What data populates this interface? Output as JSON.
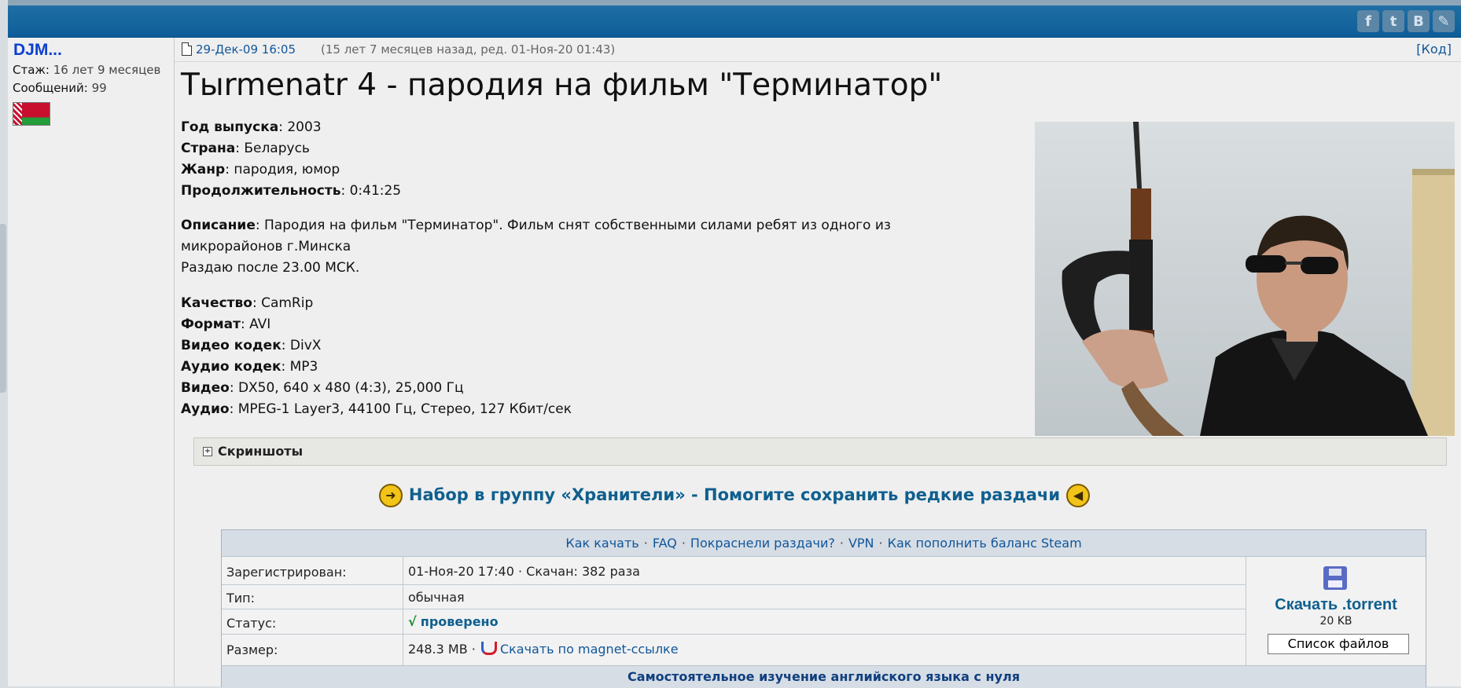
{
  "social": [
    {
      "icon": "facebook-icon",
      "glyph": "f"
    },
    {
      "icon": "twitter-icon",
      "glyph": "t"
    },
    {
      "icon": "vk-icon",
      "glyph": "B"
    },
    {
      "icon": "pencil-icon",
      "glyph": "✎"
    }
  ],
  "user": {
    "name": "DJM...",
    "stage_label": "Стаж:",
    "stage_value": "16 лет 9 месяцев",
    "posts_label": "Сообщений:",
    "posts_value": "99"
  },
  "post": {
    "date": "29-Дек-09 16:05",
    "note": "(15 лет 7 месяцев назад, ред. 01-Ноя-20 01:43)",
    "code_link": "[Код]",
    "title": "Тыrmenatr 4 - пародия на фильм \"Терминатор\""
  },
  "details": {
    "year_label": "Год выпуска",
    "year": ": 2003",
    "country_label": "Страна",
    "country": ": Беларусь",
    "genre_label": "Жанр",
    "genre": ": пародия, юмор",
    "duration_label": "Продолжительность",
    "duration": ": 0:41:25",
    "desc_label": "Описание",
    "desc_line1": ": Пародия на фильм \"Терминатор\". Фильм снят собственными силами ребят из одного из",
    "desc_line2": "микрорайонов г.Минска",
    "desc_line3": "Раздаю после 23.00 МСК.",
    "quality_label": "Качество",
    "quality": ": CamRip",
    "format_label": "Формат",
    "format": ": AVI",
    "vcodec_label": "Видео кодек",
    "vcodec": ": DivX",
    "acodec_label": "Аудио кодек",
    "acodec": ": MP3",
    "video_label": "Видео",
    "video": ": DX50, 640 x 480 (4:3), 25,000 Гц",
    "audio_label": "Аудио",
    "audio": ": MPEG-1 Layer3, 44100 Гц, Стерео, 127 Кбит/сек"
  },
  "spoiler": {
    "plus": "+",
    "label": "Скриншоты"
  },
  "banner": {
    "text": "Набор в группу «Хранители» - Помогите сохранить редкие раздачи"
  },
  "torrent": {
    "links": [
      "Как качать",
      "FAQ",
      "Покраснели раздачи?",
      "VPN",
      "Как пополнить баланс Steam"
    ],
    "registered_label": "Зарегистрирован:",
    "registered_value": "01-Ноя-20 17:40 · Скачан: 382 раза",
    "type_label": "Тип:",
    "type_value": "обычная",
    "status_label": "Статус:",
    "status_mark": "√",
    "status_value": "проверено",
    "size_label": "Размер:",
    "size_value": "248.3 MB",
    "magnet_label": "Скачать по magnet-ссылке",
    "download_title": "Скачать .torrent",
    "download_size": "20 KB",
    "files_button": "Список файлов",
    "footer": "Самостоятельное изучение английского языка с нуля"
  },
  "colors": {
    "header": "#1a68a0",
    "link": "#11569a",
    "accent": "#0f5f8e",
    "ok": "#0a8a2a"
  }
}
